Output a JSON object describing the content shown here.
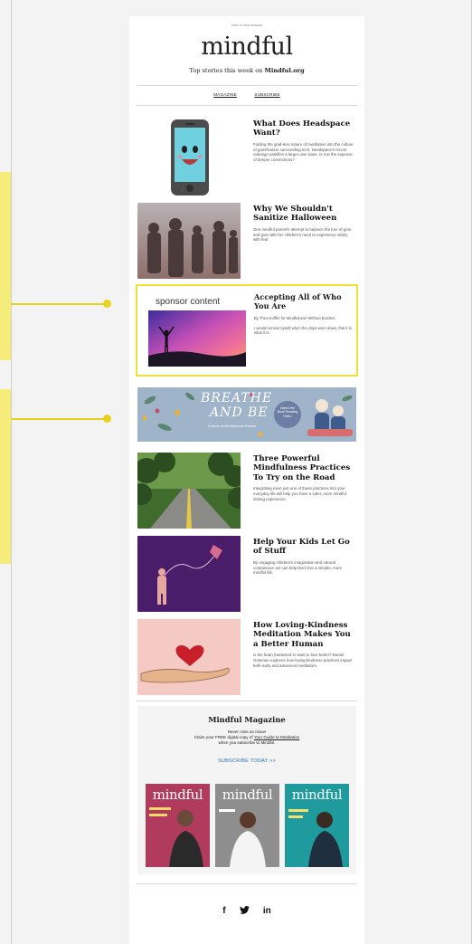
{
  "email": {
    "preheader": "View in web browser",
    "brand": "mindful",
    "tagline_prefix": "Top stories this week on ",
    "tagline_site": "Mindful.org",
    "nav": [
      "MAGAZINE",
      "SUBSCRIBE"
    ]
  },
  "stories": [
    {
      "title": "What Does Headspace Want?",
      "desc": "Folding the goal-less nature of meditation into the culture of gamification surrounding tech, Headspace's recent redesign satisfies a larger user base. Is it at the expense of deeper connections?",
      "image": "smiling-phone-illustration"
    },
    {
      "title": "Why We Shouldn't Sanitize Halloween",
      "desc": "One mindful parent's attempt to balance the lure of gore and guts with her children's need to experience safety with fear.",
      "image": "zombie-crowd-photo"
    },
    {
      "title": "Three Powerful Mindfulness Practices To Try on the Road",
      "desc": "Integrating even just one of these practices into your everyday life will help you have a safer, more mindful driving experience.",
      "image": "forest-road-photo"
    },
    {
      "title": "Help Your Kids Let Go of Stuff",
      "desc": "By engaging children's imagination and natural compassion we can help them live a simpler, more mindful life.",
      "image": "kite-illustration"
    },
    {
      "title": "How Loving-Kindness Meditation Makes You a Better Human",
      "desc": "Is the brain hardwired to want to love better? Daniel Goleman explores how loving-kindness practices impact both early and advanced meditators.",
      "image": "heart-in-hand-illustration"
    }
  ],
  "sponsor": {
    "label": "sponsor content",
    "title": "Accepting All of Who You Are",
    "byline": "By Thea Koffler for Mindfulness Without Borders",
    "desc": "I would remind myself when the chips were down, that it is what it is.",
    "image": "sunset-silhouette-photo"
  },
  "banner": {
    "line1": "BREATHE",
    "line2": "AND BE",
    "subtitle": "A Book of Mindfulness Poems",
    "badge": "Watch the Book Reading Video"
  },
  "magazine": {
    "title": "Mindful Magazine",
    "line1": "Never miss an issue!",
    "line2_prefix": "Claim your FREE digital copy of ",
    "line2_link": "Your Guide to Meditation",
    "line3": "when you subscribe to Mindful.",
    "cta": "SUBSCRIBE TODAY >>",
    "covers": [
      {
        "masthead": "mindful",
        "color": "#b13b5c"
      },
      {
        "masthead": "mindful",
        "color": "#8e8e8e"
      },
      {
        "masthead": "mindful",
        "color": "#1f9a9d"
      }
    ]
  },
  "social": {
    "facebook": "f",
    "twitter": "twitter-bird",
    "linkedin": "in"
  },
  "colors": {
    "highlight": "#f0e03a",
    "link": "#2b6fb0"
  }
}
